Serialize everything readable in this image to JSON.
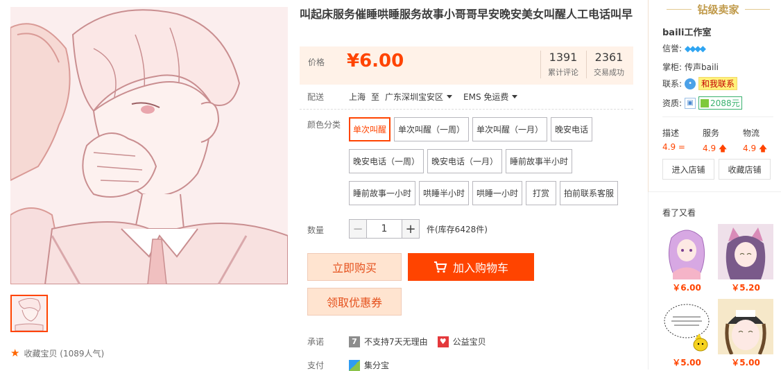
{
  "product": {
    "title": "叫起床服务催睡哄睡服务故事小哥哥早安晚安美女叫醒人工电话叫早",
    "price_label": "价格",
    "price": "¥6.00",
    "reviews_count": "1391",
    "reviews_label": "累计评论",
    "deals_count": "2361",
    "deals_label": "交易成功"
  },
  "shipping": {
    "label": "配送",
    "from": "上海",
    "to_word": "至",
    "to": "广东深圳宝安区",
    "method": "EMS 免运费"
  },
  "sku": {
    "label": "颜色分类",
    "options": [
      "单次叫醒",
      "单次叫醒（一周）",
      "单次叫醒（一月）",
      "晚安电话",
      "晚安电话（一周）",
      "晚安电话（一月）",
      "睡前故事半小时",
      "睡前故事一小时",
      "哄睡半小时",
      "哄睡一小时",
      "打赏",
      "拍前联系客服"
    ],
    "selected_index": 0
  },
  "quantity": {
    "label": "数量",
    "value": "1",
    "minus": "−",
    "plus": "+",
    "stock": "件(库存6428件)"
  },
  "buttons": {
    "buy_now": "立即购买",
    "add_cart": "加入购物车",
    "coupon": "领取优惠券"
  },
  "promise": {
    "label": "承诺",
    "item1_icon": "7",
    "item1": "不支持7天无理由",
    "item2": "公益宝贝"
  },
  "payment": {
    "label": "支付",
    "item1": "集分宝"
  },
  "gallery": {
    "favorite": "收藏宝贝 (1089人气)"
  },
  "shop": {
    "badge": "钻级卖家",
    "name": "baili工作室",
    "credit_label": "信誉:",
    "credit_icons": "💎💎💎💎",
    "keeper_label": "掌柜:",
    "keeper": "传声baili",
    "contact_label": "联系:",
    "contact": "和我联系",
    "qual_label": "资质:",
    "qual_amount": "2088元",
    "scores": [
      {
        "label": "描述",
        "value": "4.9",
        "mark": "="
      },
      {
        "label": "服务",
        "value": "4.9",
        "mark": "🡅"
      },
      {
        "label": "物流",
        "value": "4.9",
        "mark": "🡅"
      }
    ],
    "enter": "进入店铺",
    "collect": "收藏店铺"
  },
  "also_viewed": {
    "title": "看了又看",
    "items": [
      {
        "price": "￥6.00"
      },
      {
        "price": "￥5.20"
      },
      {
        "price": "￥5.00"
      },
      {
        "price": "￥5.00"
      }
    ]
  },
  "colors": {
    "accent": "#ff4400",
    "price_bg": "#fff2e8",
    "gold": "#c09a4a"
  }
}
